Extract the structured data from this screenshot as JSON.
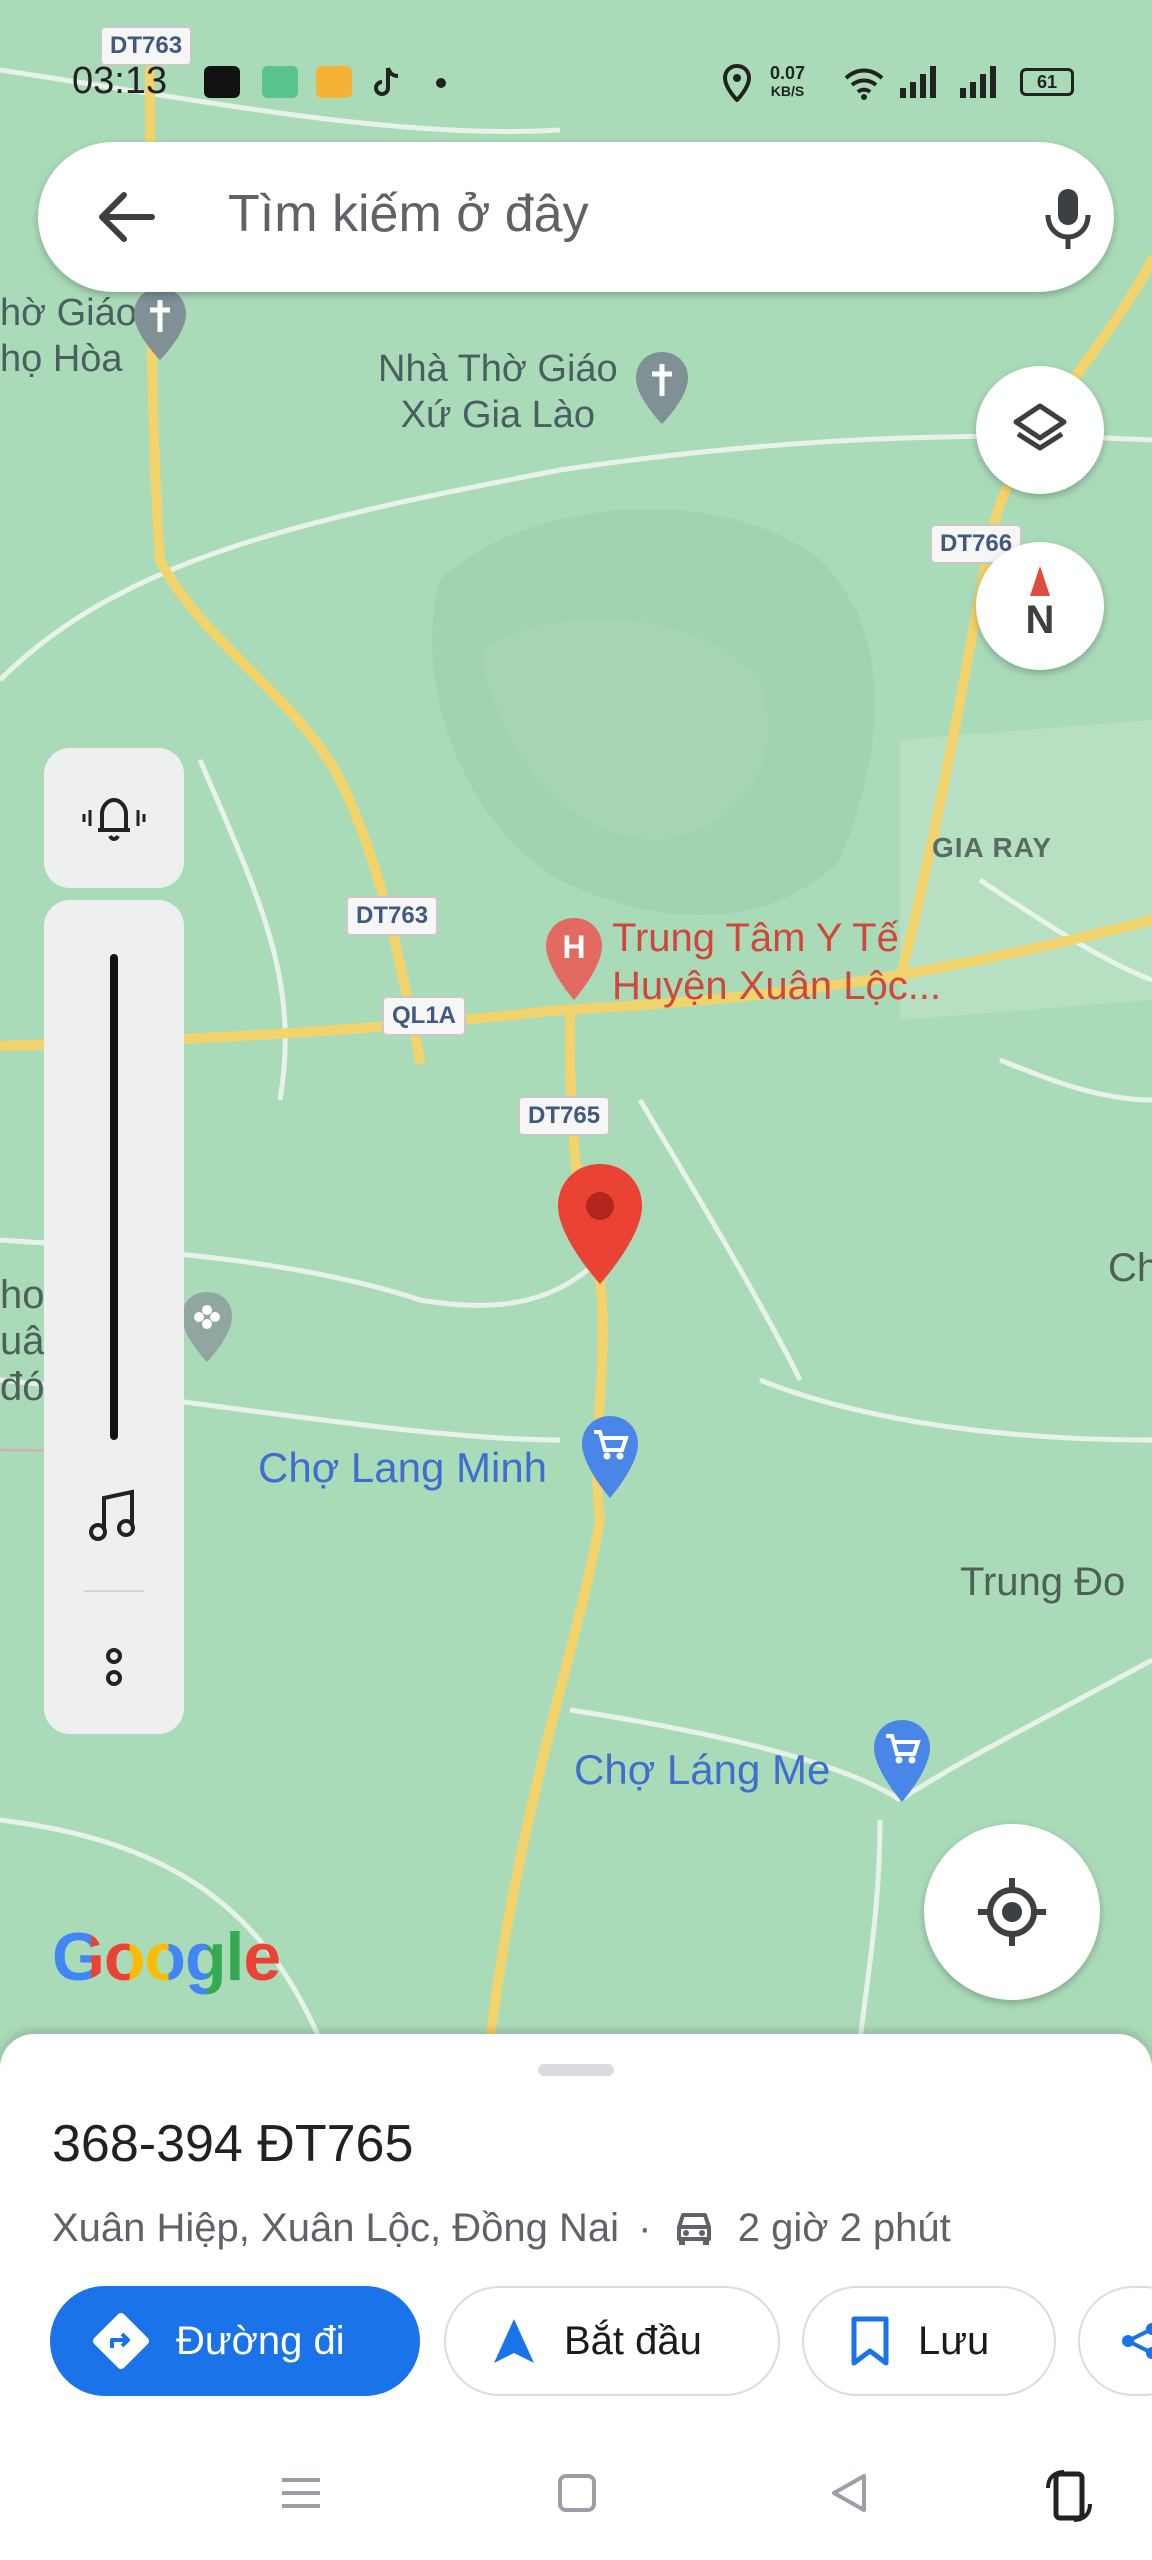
{
  "status_bar": {
    "time": "03:13",
    "net_speed_value": "0.07",
    "net_speed_unit": "KB/S",
    "battery": "61"
  },
  "search": {
    "placeholder": "Tìm kiếm ở đây"
  },
  "map": {
    "labels": {
      "church_left_line1": "hờ Giáo",
      "church_left_line2": "họ Hòa",
      "church_main_line1": "Nhà Thờ Giáo",
      "church_main_line2": "Xứ Gia Lào",
      "gia_ray": "GIA RAY",
      "hospital_line1": "Trung Tâm Y Tế",
      "hospital_line2": "Huyện Xuân Lộc...",
      "market_1": "Chợ Lang Minh",
      "market_2": "Chợ Láng Me",
      "trung_do": "Trung Đo",
      "ch_right": "Ch",
      "left_edge_1": "ho",
      "left_edge_2": "uâ",
      "left_edge_3": "đó",
      "google_logo": "Google"
    },
    "road_shields": {
      "dt763_top": "DT763",
      "dt766": "DT766",
      "dt763": "DT763",
      "ql1a": "QL1A",
      "dt765": "DT765"
    },
    "compass_label": "N"
  },
  "place": {
    "title": "368-394 ĐT765",
    "address": "Xuân Hiệp, Xuân Lộc, Đồng Nai",
    "separator": "·",
    "travel_time": "2 giờ 2 phút"
  },
  "actions": {
    "directions": "Đường đi",
    "start": "Bắt đầu",
    "save": "Lưu"
  },
  "colors": {
    "map_green": "#aadbb8",
    "road_yellow": "#f3d36b",
    "accent_blue": "#1a73e8",
    "pin_red": "#ea4335"
  }
}
